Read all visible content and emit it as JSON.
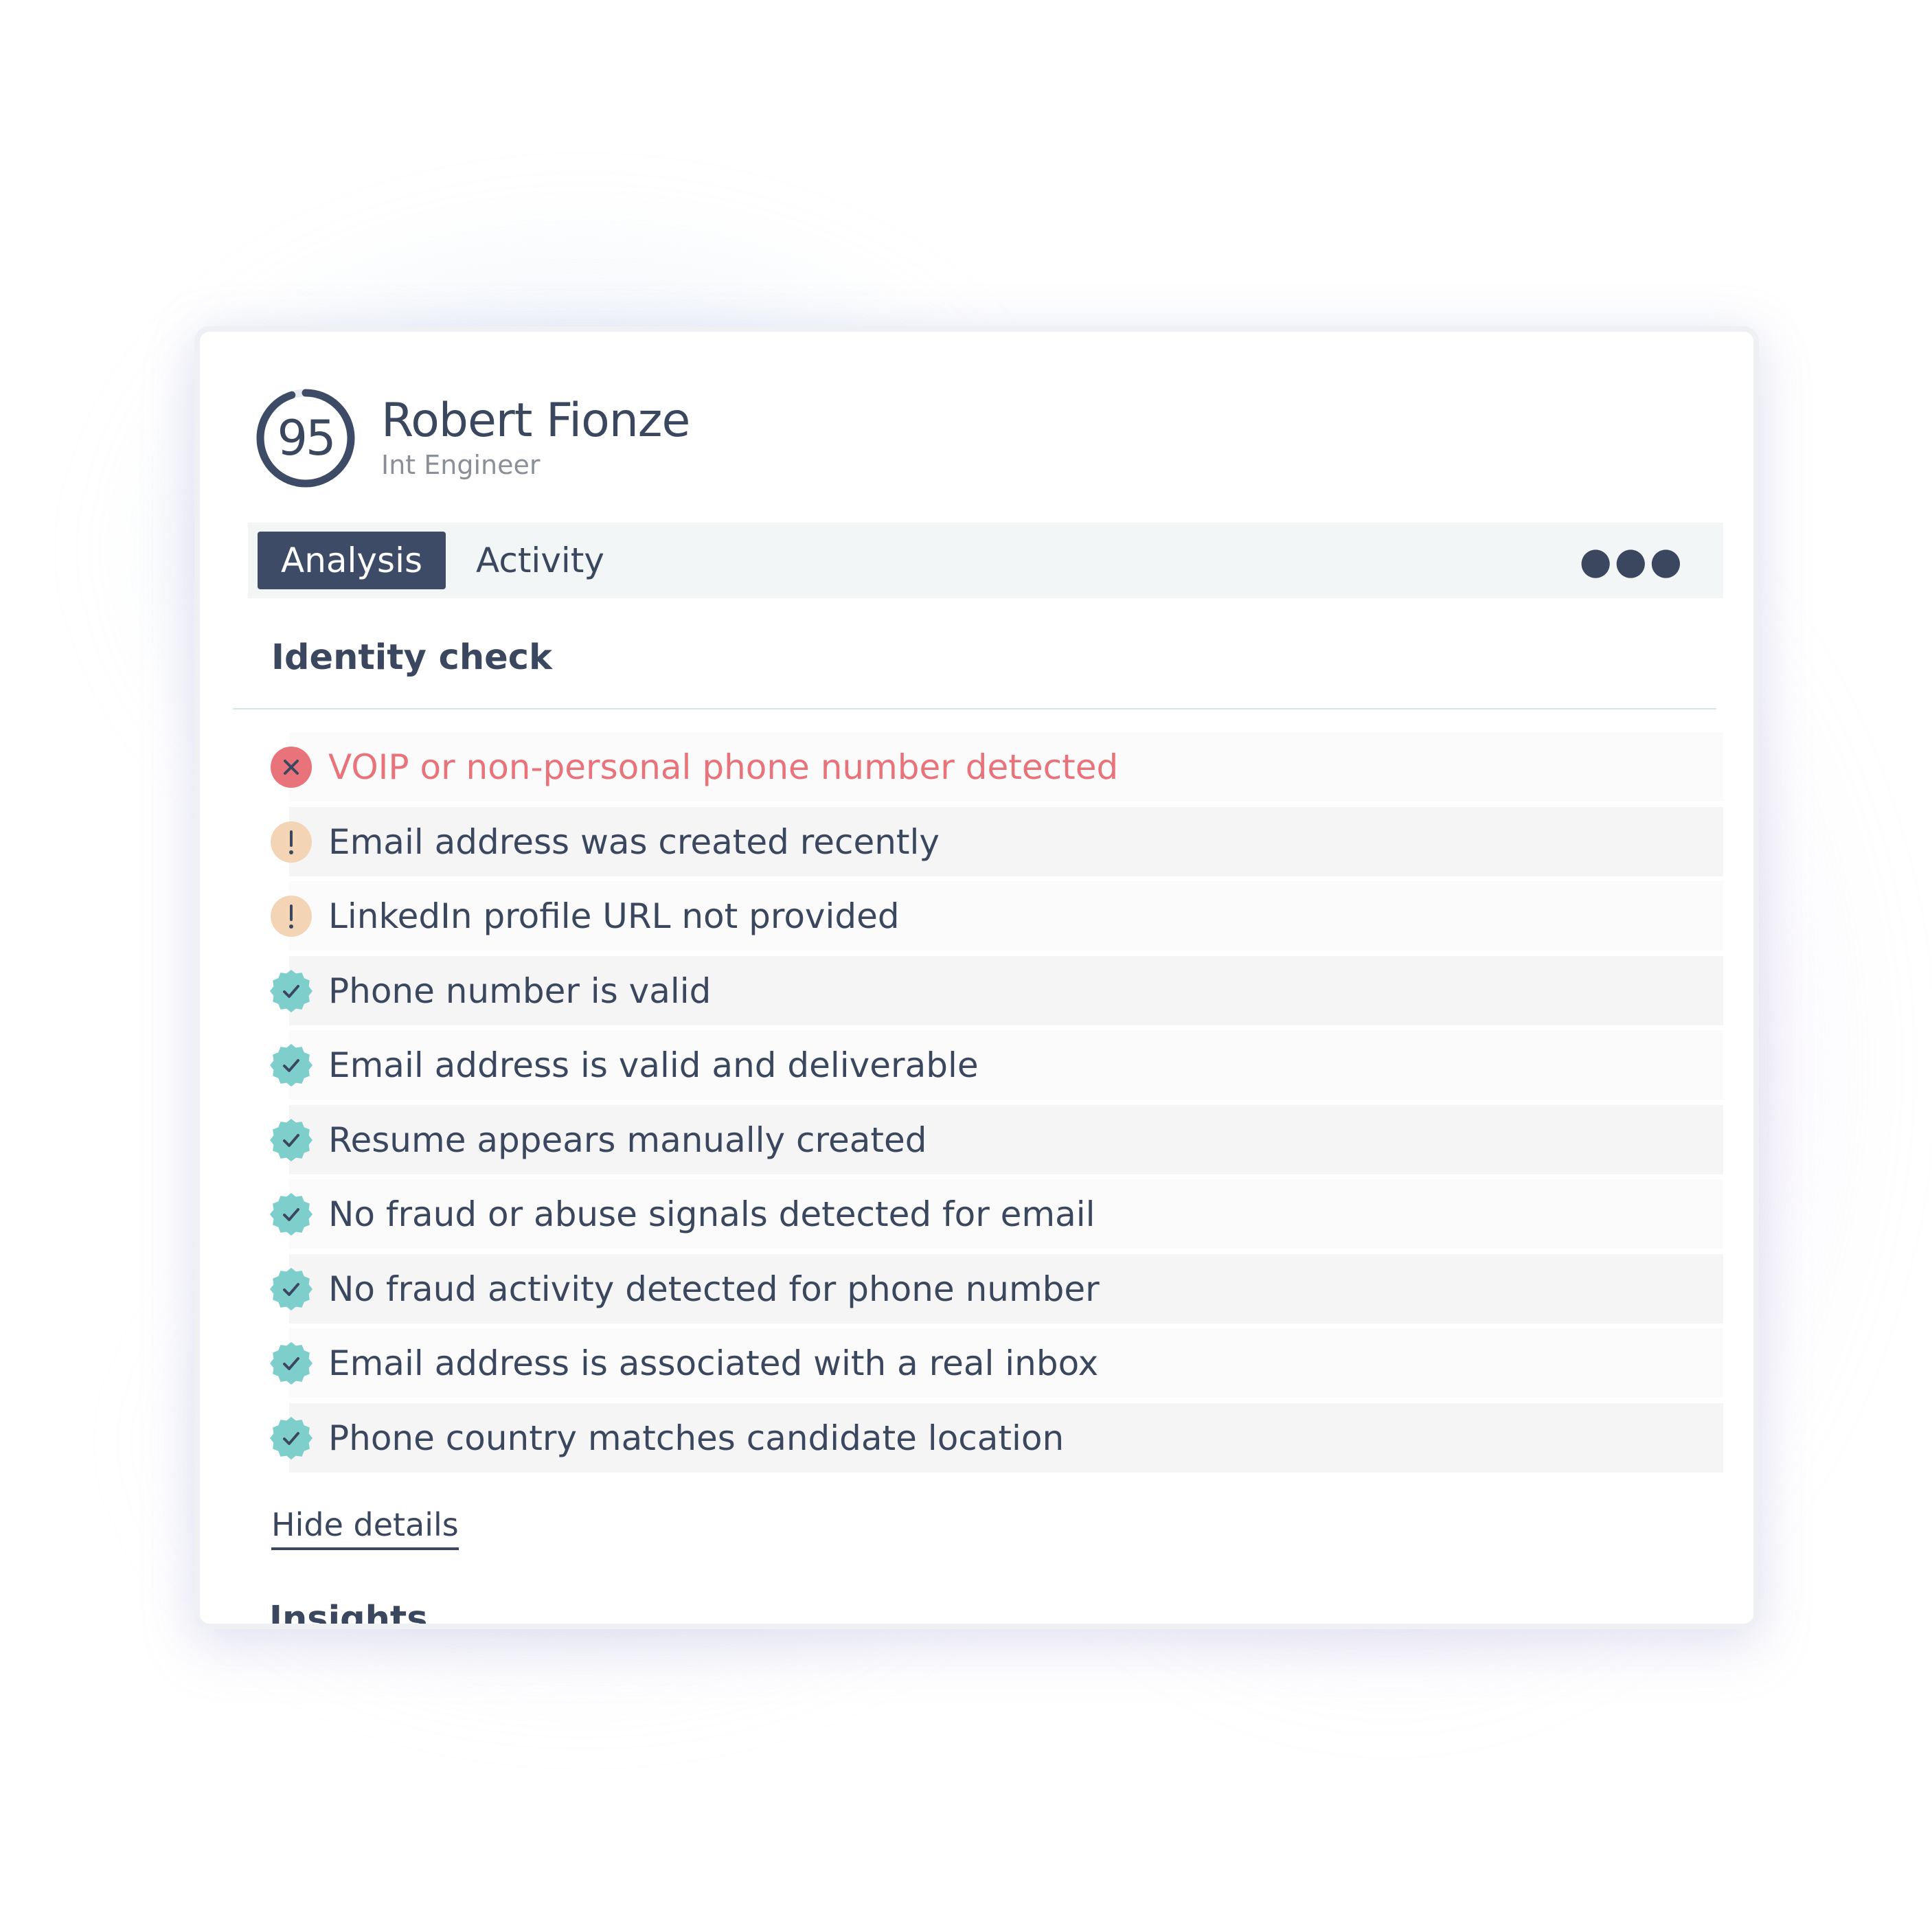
{
  "candidate": {
    "score": "95",
    "score_fraction": 0.95,
    "name": "Robert Fionze",
    "role": "Int Engineer"
  },
  "tabs": [
    {
      "label": "Analysis",
      "active": true
    },
    {
      "label": "Activity",
      "active": false
    }
  ],
  "more_menu_icon": "more-horizontal-icon",
  "identity_check": {
    "title": "Identity check",
    "items": [
      {
        "status": "error",
        "icon": "error-x-icon",
        "text": "VOIP or non-personal phone number detected"
      },
      {
        "status": "warning",
        "icon": "warning-exclamation-icon",
        "text": "Email address was created recently"
      },
      {
        "status": "warning",
        "icon": "warning-exclamation-icon",
        "text": "LinkedIn profile URL not provided"
      },
      {
        "status": "pass",
        "icon": "verified-badge-check-icon",
        "text": "Phone number is valid"
      },
      {
        "status": "pass",
        "icon": "verified-badge-check-icon",
        "text": "Email address is valid and deliverable"
      },
      {
        "status": "pass",
        "icon": "verified-badge-check-icon",
        "text": "Resume appears manually created"
      },
      {
        "status": "pass",
        "icon": "verified-badge-check-icon",
        "text": "No fraud or abuse signals detected for email"
      },
      {
        "status": "pass",
        "icon": "verified-badge-check-icon",
        "text": "No fraud activity detected for phone number"
      },
      {
        "status": "pass",
        "icon": "verified-badge-check-icon",
        "text": "Email address is associated with a real inbox"
      },
      {
        "status": "pass",
        "icon": "verified-badge-check-icon",
        "text": "Phone country matches candidate location"
      }
    ],
    "toggle_label": "Hide details"
  },
  "next_section_title": "Insights",
  "colors": {
    "primary": "#3d4b66",
    "text": "#3a475e",
    "muted": "#8a8f98",
    "error": "#e8737a",
    "warning_bg": "#f3d4b4",
    "pass": "#7ecfcc"
  }
}
